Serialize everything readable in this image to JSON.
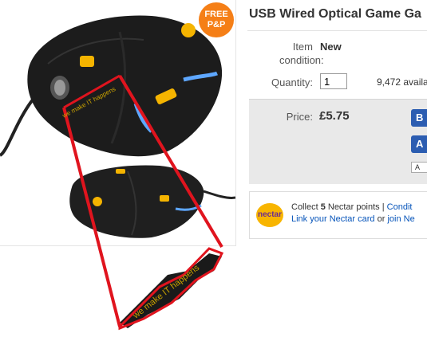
{
  "product": {
    "title": "USB Wired Optical Game Ga",
    "badge_line1": "FREE",
    "badge_line2": "P&P",
    "brand_text": "we make IT happens"
  },
  "details": {
    "condition_label_1": "Item",
    "condition_label_2": "condition:",
    "condition_value": "New",
    "quantity_label": "Quantity:",
    "quantity_value": "1",
    "available": "9,472 availa",
    "price_label": "Price:",
    "price_value": "£5.75",
    "buy_button": "B",
    "add_button": "A",
    "watch_button": "A"
  },
  "nectar": {
    "logo_text": "nectar",
    "collect_prefix": "Collect ",
    "points": "5",
    "collect_suffix": " Nectar points",
    "separator": " | ",
    "conditions_link": "Condit",
    "link_card": "Link your Nectar card",
    "or_text": " or ",
    "join_link": "join Ne"
  },
  "colors": {
    "badge": "#f57f17",
    "accent_yellow": "#f5b400",
    "annotation_red": "#e0141e",
    "link": "#0654ba",
    "button": "#2c5db1"
  }
}
